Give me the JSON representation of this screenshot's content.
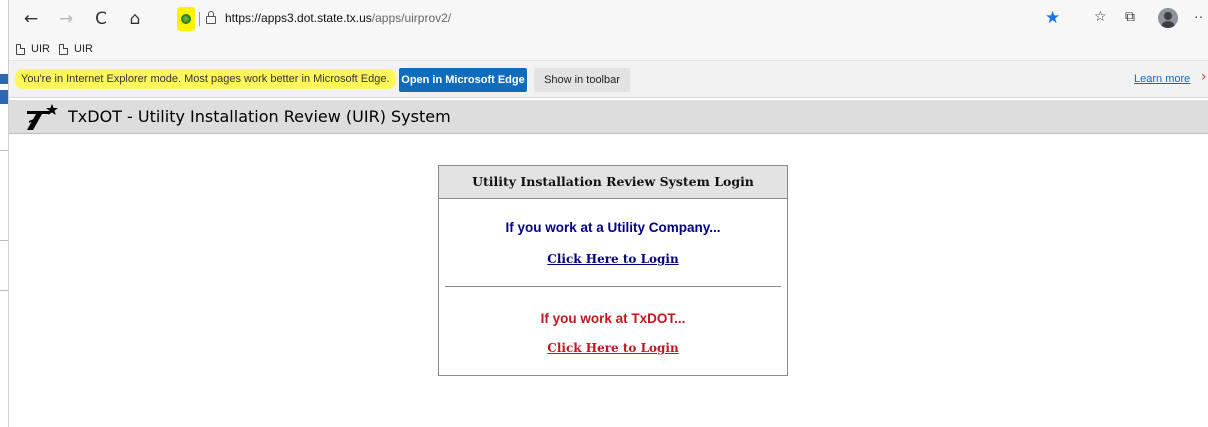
{
  "browser": {
    "url_host": "https://apps3.dot.state.tx.us",
    "url_path": "/apps/uirprov2/",
    "nav": {
      "back": "←",
      "forward": "→",
      "refresh": "C",
      "home": "⌂"
    }
  },
  "favorites": [
    {
      "label": "UIR"
    },
    {
      "label": "UIR"
    }
  ],
  "infobar": {
    "message": "You're in Internet Explorer mode. Most pages work better in Microsoft Edge.",
    "open_button": "Open in Microsoft Edge",
    "show_button": "Show in toolbar",
    "learn_more": "Learn more",
    "close": "›"
  },
  "page": {
    "title": "TxDOT - Utility Installation Review (UIR) System"
  },
  "login": {
    "heading": "Utility Installation Review System Login",
    "utility": {
      "title": "If you work at a Utility Company...",
      "link": "Click Here to Login",
      "color": "#00007f"
    },
    "txdot": {
      "title": "If you work at TxDOT...",
      "link": "Click Here to Login",
      "color": "#c0161e"
    }
  },
  "colors": {
    "highlight": "#fff75a",
    "accent": "#0f6cbd"
  }
}
